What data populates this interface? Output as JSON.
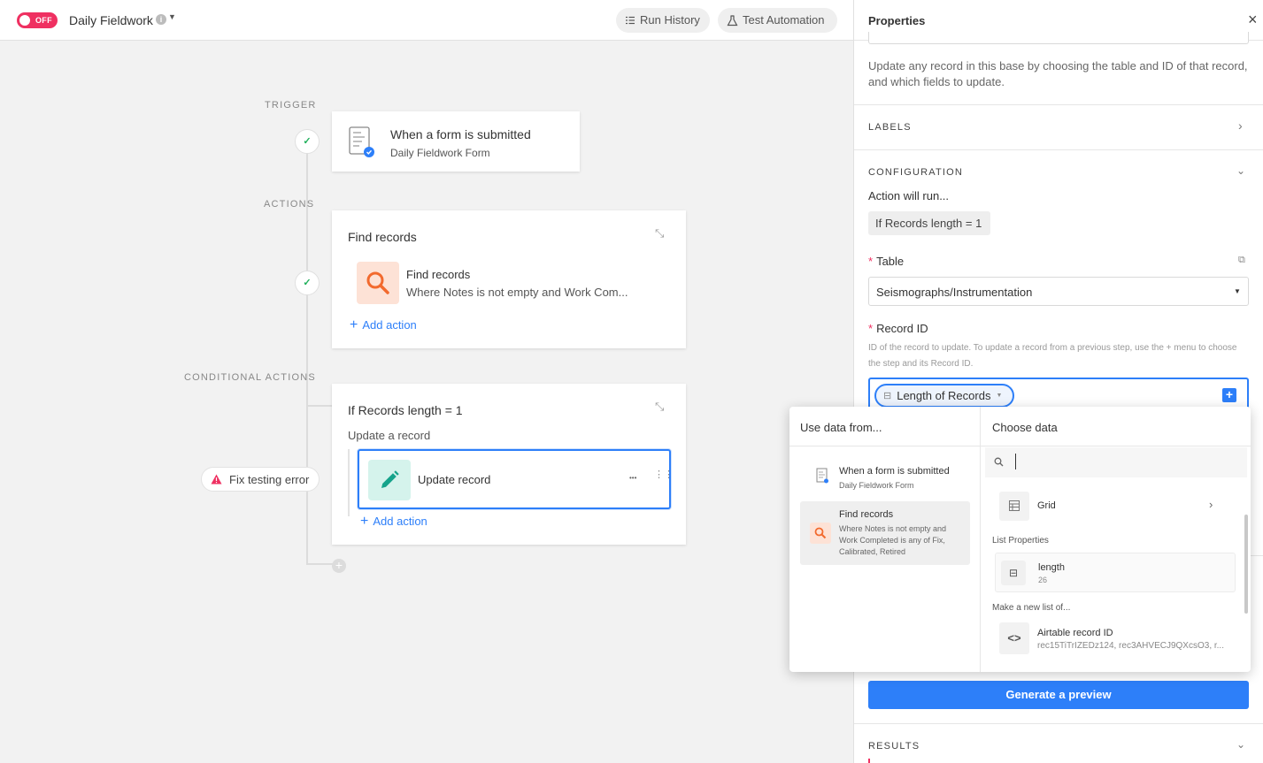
{
  "header": {
    "toggle_label": "OFF",
    "automation_name": "Daily Fieldwork",
    "info_icon_text": "i",
    "run_history": "Run History",
    "test_automation": "Test Automation"
  },
  "canvas": {
    "trigger_label": "TRIGGER",
    "actions_label": "ACTIONS",
    "conditional_label": "CONDITIONAL ACTIONS",
    "trigger_card": {
      "title": "When a form is submitted",
      "subtitle": "Daily Fieldwork Form"
    },
    "find_card": {
      "title": "Find records",
      "action_title": "Find records",
      "action_desc": "Where Notes is not empty and Work Com...",
      "add_action": "Add action"
    },
    "conditional_card": {
      "title": "If Records length = 1",
      "subtitle": "Update a record",
      "action_title": "Update record",
      "more": "•••",
      "add_action": "Add action"
    },
    "error_badge": "Fix testing error"
  },
  "properties": {
    "title": "Properties",
    "close": "×",
    "description": "Update any record in this base by choosing the table and ID of that record, and which fields to update.",
    "labels_section": "LABELS",
    "configuration_section": "CONFIGURATION",
    "will_run": "Action will run...",
    "condition_chip": "If Records length = 1",
    "table_label": "Table",
    "required_mark": "*",
    "table_value": "Seismographs/Instrumentation",
    "record_id_label": "Record ID",
    "record_id_help": "ID of the record to update. To update a record from a previous step, use the + menu to choose the step and its Record ID.",
    "record_id_token": "Length of Records",
    "generate_preview": "Generate a preview",
    "results_section": "RESULTS"
  },
  "popup": {
    "use_data_header": "Use data from...",
    "choose_data_header": "Choose data",
    "sources": [
      {
        "title": "When a form is submitted",
        "subtitle": "Daily Fieldwork Form",
        "selected": false
      },
      {
        "title": "Find records",
        "subtitle": "Where Notes is not empty and Work Completed is any of Fix, Calibrated, Retired",
        "selected": true
      }
    ],
    "search_value": "",
    "grid_label": "Grid",
    "list_properties_label": "List Properties",
    "length_item": {
      "name": "length",
      "value": "26"
    },
    "make_list_label": "Make a new list of...",
    "record_id_item": {
      "name": "Airtable record ID",
      "value": "rec15TiTrIZEDz124, rec3AHVECJ9QXcsO3, r..."
    }
  },
  "colors": {
    "accent": "#2d7ff9",
    "toggle_red": "#ef3061",
    "success": "#20b05b",
    "find_icon_bg": "#fde2d6",
    "find_icon": "#f26a2e",
    "update_icon_bg": "#d5f3ec",
    "update_icon": "#15a38b"
  }
}
